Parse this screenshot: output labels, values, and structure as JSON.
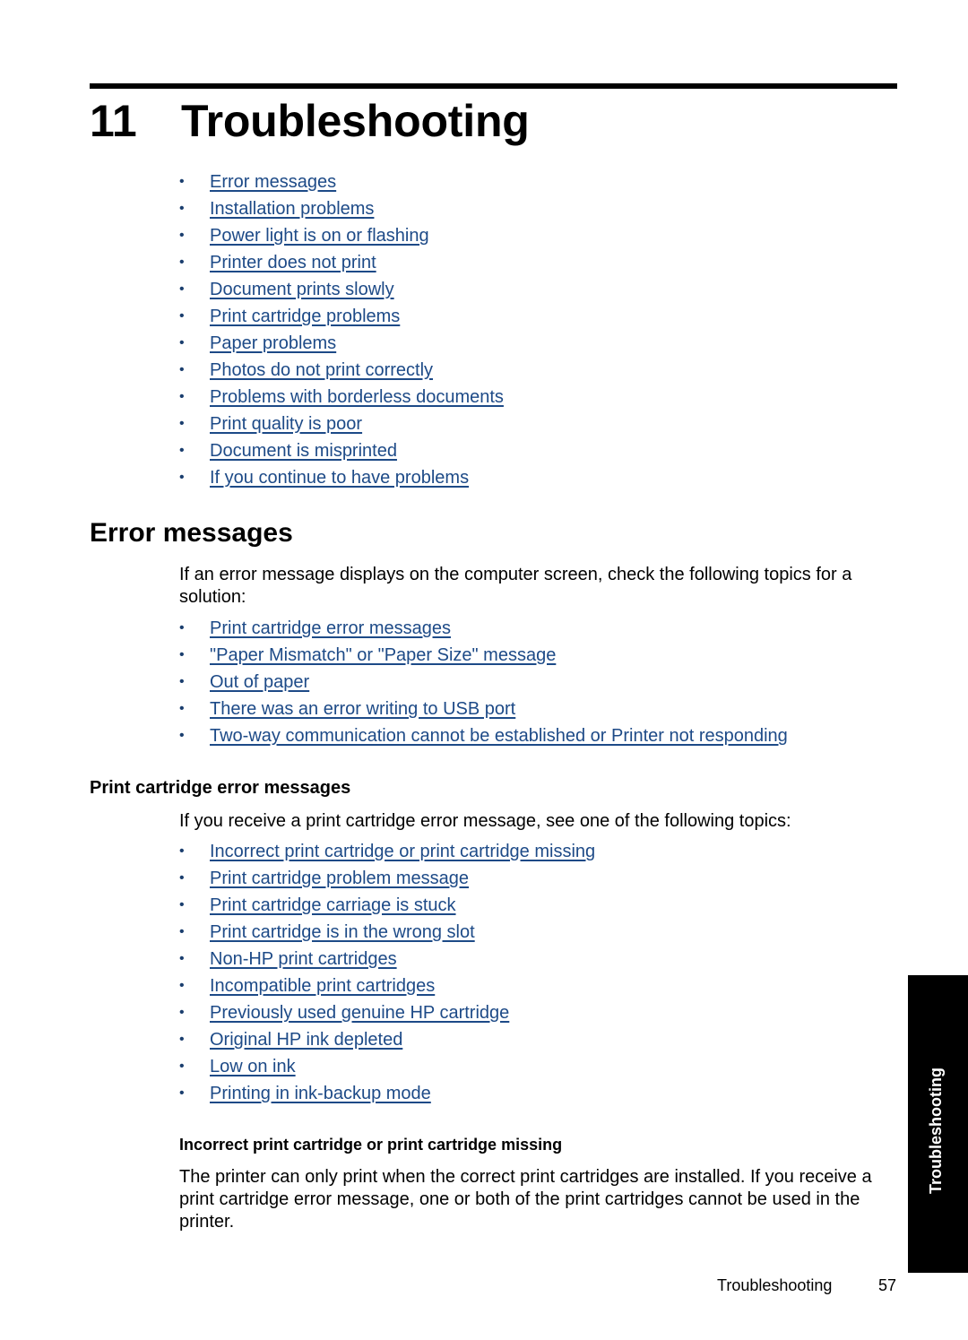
{
  "chapter": {
    "number": "11",
    "title": "Troubleshooting"
  },
  "toc_links": [
    "Error messages",
    "Installation problems",
    "Power light is on or flashing",
    "Printer does not print",
    "Document prints slowly",
    "Print cartridge problems",
    "Paper problems",
    "Photos do not print correctly",
    "Problems with borderless documents",
    "Print quality is poor",
    "Document is misprinted",
    "If you continue to have problems"
  ],
  "error_messages": {
    "heading": "Error messages",
    "intro": "If an error message displays on the computer screen, check the following topics for a solution:",
    "links": [
      "Print cartridge error messages",
      "\"Paper Mismatch\" or \"Paper Size\" message",
      "Out of paper",
      "There was an error writing to USB port",
      "Two-way communication cannot be established or Printer not responding"
    ]
  },
  "print_cartridge_errors": {
    "heading": "Print cartridge error messages",
    "intro": "If you receive a print cartridge error message, see one of the following topics:",
    "links": [
      "Incorrect print cartridge or print cartridge missing",
      "Print cartridge problem message",
      "Print cartridge carriage is stuck",
      "Print cartridge is in the wrong slot",
      "Non-HP print cartridges",
      "Incompatible print cartridges",
      "Previously used genuine HP cartridge",
      "Original HP ink depleted",
      "Low on ink",
      "Printing in ink-backup mode"
    ]
  },
  "incorrect_cartridge": {
    "heading": "Incorrect print cartridge or print cartridge missing",
    "body": "The printer can only print when the correct print cartridges are installed. If you receive a print cartridge error message, one or both of the print cartridges cannot be used in the printer."
  },
  "thumb_tab": {
    "label": "Troubleshooting"
  },
  "footer": {
    "section": "Troubleshooting",
    "page_number": "57"
  },
  "colors": {
    "link": "#1d4a87",
    "text": "#000000"
  }
}
